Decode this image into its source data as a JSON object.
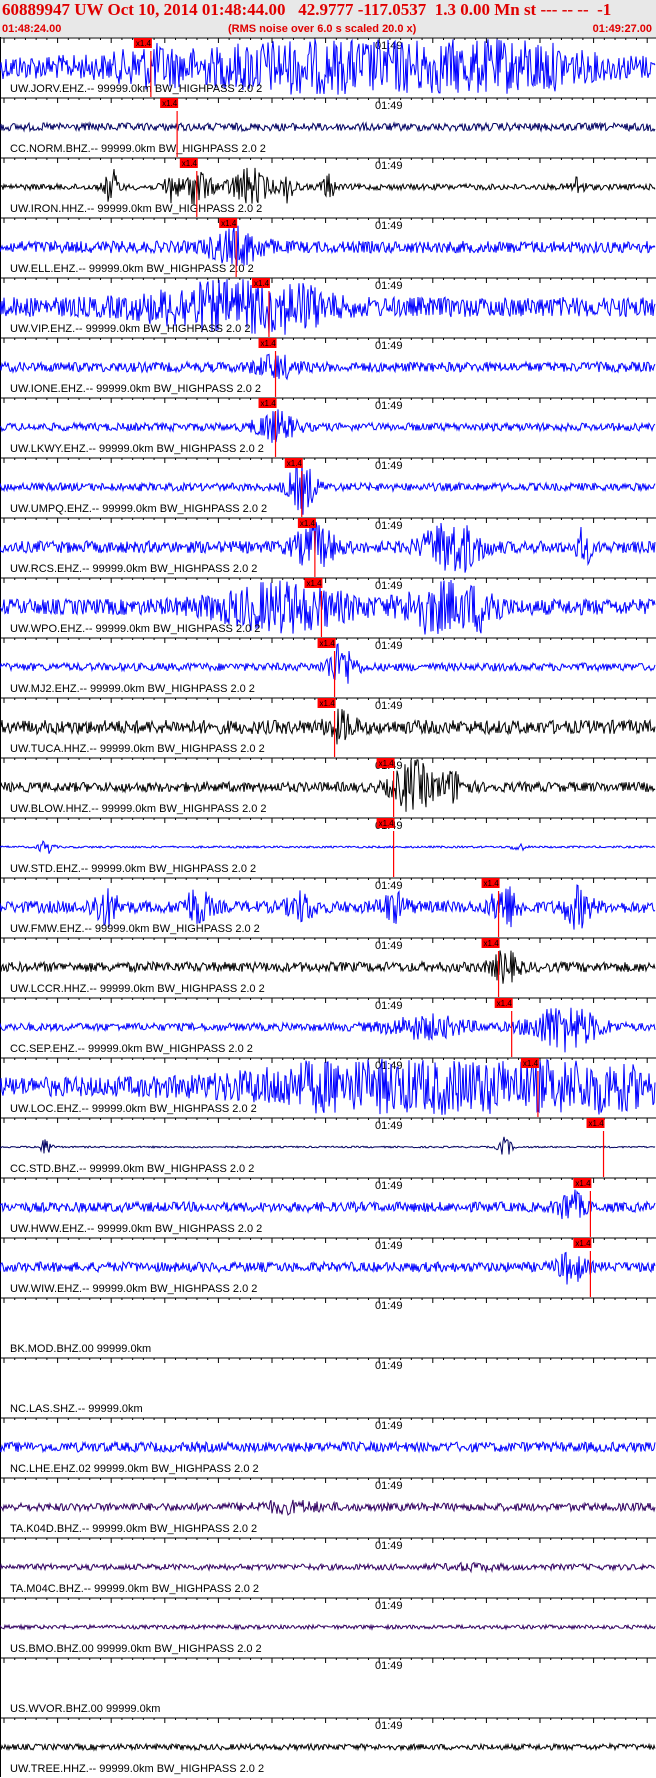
{
  "header": {
    "title": "60889947 UW Oct 10, 2014 01:48:44.00   42.9777 -117.0537  1.3 0.00 Mn st --- -- --  -1",
    "start_time": "01:48:24.00",
    "rms_note": "(RMS noise over 6.0 s scaled 20.0 x)",
    "end_time": "01:49:27.00"
  },
  "time_mark_label": "01:49",
  "pick_label": "x1.4",
  "colors": {
    "blue": "#0000ff",
    "black": "#000000",
    "navy": "#000060",
    "purple": "#300060",
    "pick": "#ff0000"
  },
  "traces": [
    {
      "label": "UW.JORV.EHZ.-- 99999.0km BW_HIGHPASS  2.0  2",
      "color": "blue",
      "amp": 12,
      "pick": 0.23,
      "bursts": [
        [
          0.23,
          0.05,
          10
        ],
        [
          0.55,
          0.2,
          30
        ],
        [
          0.7,
          0.12,
          40
        ]
      ]
    },
    {
      "label": "CC.NORM.BHZ.-- 99999.0km BW_HIGHPASS  2.0  2",
      "color": "navy",
      "amp": 4,
      "pick": 0.27,
      "bursts": []
    },
    {
      "label": "UW.IRON.HHZ.-- 99999.0km BW_HIGHPASS  2.0  2",
      "color": "black",
      "amp": 3,
      "pick": 0.3,
      "bursts": [
        [
          0.17,
          0.01,
          18
        ],
        [
          0.26,
          0.01,
          16
        ],
        [
          0.3,
          0.02,
          18
        ],
        [
          0.38,
          0.03,
          18
        ],
        [
          0.44,
          0.01,
          14
        ],
        [
          0.5,
          0.01,
          12
        ],
        [
          0.88,
          0.01,
          10
        ]
      ]
    },
    {
      "label": "UW.ELL.EHZ.-- 99999.0km BW_HIGHPASS  2.0  2",
      "color": "blue",
      "amp": 6,
      "pick": 0.36,
      "bursts": [
        [
          0.36,
          0.04,
          16
        ]
      ]
    },
    {
      "label": "UW.VIP.EHZ.-- 99999.0km BW_HIGHPASS  2.0  2",
      "color": "blue",
      "amp": 10,
      "pick": 0.41,
      "bursts": [
        [
          0.32,
          0.1,
          16
        ],
        [
          0.43,
          0.06,
          22
        ]
      ]
    },
    {
      "label": "UW.IONE.EHZ.-- 99999.0km BW_HIGHPASS  2.0  2",
      "color": "blue",
      "amp": 5,
      "pick": 0.42,
      "bursts": [
        [
          0.42,
          0.03,
          10
        ]
      ]
    },
    {
      "label": "UW.LKWY.EHZ.-- 99999.0km BW_HIGHPASS  2.0  2",
      "color": "blue",
      "amp": 4,
      "pick": 0.42,
      "bursts": [
        [
          0.42,
          0.03,
          14
        ]
      ]
    },
    {
      "label": "UW.UMPQ.EHZ.-- 99999.0km BW_HIGHPASS  2.0  2",
      "color": "blue",
      "amp": 4,
      "pick": 0.46,
      "bursts": [
        [
          0.46,
          0.02,
          24
        ]
      ]
    },
    {
      "label": "UW.RCS.EHZ.-- 99999.0km BW_HIGHPASS  2.0  2",
      "color": "blue",
      "amp": 6,
      "pick": 0.48,
      "bursts": [
        [
          0.48,
          0.03,
          20
        ],
        [
          0.69,
          0.04,
          26
        ],
        [
          0.89,
          0.01,
          18
        ]
      ]
    },
    {
      "label": "UW.WPO.EHZ.-- 99999.0km BW_HIGHPASS  2.0  2",
      "color": "blue",
      "amp": 8,
      "pick": 0.49,
      "bursts": [
        [
          0.43,
          0.1,
          20
        ],
        [
          0.67,
          0.05,
          24
        ],
        [
          0.74,
          0.02,
          22
        ]
      ]
    },
    {
      "label": "UW.MJ2.EHZ.-- 99999.0km BW_HIGHPASS  2.0  2",
      "color": "blue",
      "amp": 4,
      "pick": 0.51,
      "bursts": [
        [
          0.52,
          0.02,
          22
        ]
      ]
    },
    {
      "label": "UW.TUCA.HHZ.-- 99999.0km BW_HIGHPASS  2.0  2",
      "color": "black",
      "amp": 7,
      "pick": 0.51,
      "bursts": [
        [
          0.52,
          0.02,
          12
        ]
      ]
    },
    {
      "label": "UW.BLOW.HHZ.-- 99999.0km BW_HIGHPASS  2.0  2",
      "color": "black",
      "amp": 5,
      "pick": 0.6,
      "bursts": [
        [
          0.63,
          0.03,
          24
        ],
        [
          0.69,
          0.02,
          14
        ]
      ]
    },
    {
      "label": "UW.STD.EHZ.-- 99999.0km BW_HIGHPASS  2.0  2",
      "color": "blue",
      "amp": 1,
      "pick": 0.6,
      "bursts": [
        [
          0.07,
          0.01,
          8
        ],
        [
          0.79,
          0.01,
          4
        ]
      ]
    },
    {
      "label": "UW.FMW.EHZ.-- 99999.0km BW_HIGHPASS  2.0  2",
      "color": "blue",
      "amp": 6,
      "pick": 0.76,
      "bursts": [
        [
          0.16,
          0.02,
          16
        ],
        [
          0.3,
          0.02,
          16
        ],
        [
          0.46,
          0.02,
          12
        ],
        [
          0.6,
          0.02,
          12
        ],
        [
          0.77,
          0.02,
          20
        ],
        [
          0.88,
          0.02,
          18
        ]
      ]
    },
    {
      "label": "UW.LCCR.HHZ.-- 99999.0km BW_HIGHPASS  2.0  2",
      "color": "black",
      "amp": 5,
      "pick": 0.76,
      "bursts": [
        [
          0.77,
          0.02,
          14
        ]
      ]
    },
    {
      "label": "CC.SEP.EHZ.-- 99999.0km BW_HIGHPASS  2.0  2",
      "color": "blue",
      "amp": 4,
      "pick": 0.78,
      "bursts": [
        [
          0.65,
          0.06,
          10
        ],
        [
          0.86,
          0.05,
          22
        ]
      ]
    },
    {
      "label": "UW.LOC.EHZ.-- 99999.0km BW_HIGHPASS  2.0  2",
      "color": "blue",
      "amp": 10,
      "pick": 0.82,
      "bursts": [
        [
          0.55,
          0.18,
          20
        ],
        [
          0.82,
          0.16,
          30
        ]
      ]
    },
    {
      "label": "CC.STD.BHZ.-- 99999.0km BW_HIGHPASS  2.0  2",
      "color": "navy",
      "amp": 0.8,
      "pick": 0.92,
      "bursts": [
        [
          0.07,
          0.01,
          8
        ],
        [
          0.77,
          0.01,
          10
        ]
      ]
    },
    {
      "label": "UW.HWW.EHZ.-- 99999.0km BW_HIGHPASS  2.0  2",
      "color": "blue",
      "amp": 5,
      "pick": 0.9,
      "bursts": [
        [
          0.87,
          0.02,
          14
        ]
      ]
    },
    {
      "label": "UW.WIW.EHZ.-- 99999.0km BW_HIGHPASS  2.0  2",
      "color": "blue",
      "amp": 5,
      "pick": 0.9,
      "bursts": [
        [
          0.87,
          0.02,
          14
        ]
      ]
    },
    {
      "label": "BK.MOD.BHZ.00 99999.0km",
      "color": "none",
      "amp": 0,
      "pick": null,
      "bursts": []
    },
    {
      "label": "NC.LAS.SHZ.-- 99999.0km",
      "color": "none",
      "amp": 0,
      "pick": null,
      "bursts": []
    },
    {
      "label": "NC.LHE.EHZ.02 99999.0km BW_HIGHPASS  2.0  2",
      "color": "blue",
      "amp": 5,
      "pick": null,
      "bursts": []
    },
    {
      "label": "TA.K04D.BHZ.-- 99999.0km BW_HIGHPASS  2.0  2",
      "color": "purple",
      "amp": 4,
      "pick": null,
      "bursts": [
        [
          0.44,
          0.05,
          4
        ]
      ]
    },
    {
      "label": "TA.M04C.BHZ.-- 99999.0km BW_HIGHPASS  2.0  2",
      "color": "purple",
      "amp": 3,
      "pick": null,
      "bursts": [
        [
          0.72,
          0.04,
          2
        ]
      ]
    },
    {
      "label": "US.BMO.BHZ.00 99999.0km BW_HIGHPASS  2.0  2",
      "color": "purple",
      "amp": 2,
      "pick": null,
      "bursts": []
    },
    {
      "label": "US.WVOR.BHZ.00 99999.0km",
      "color": "none",
      "amp": 0,
      "pick": null,
      "bursts": []
    },
    {
      "label": "UW.TREE.HHZ.-- 99999.0km BW_HIGHPASS  2.0  2",
      "color": "black",
      "amp": 3,
      "pick": null,
      "bursts": []
    }
  ]
}
